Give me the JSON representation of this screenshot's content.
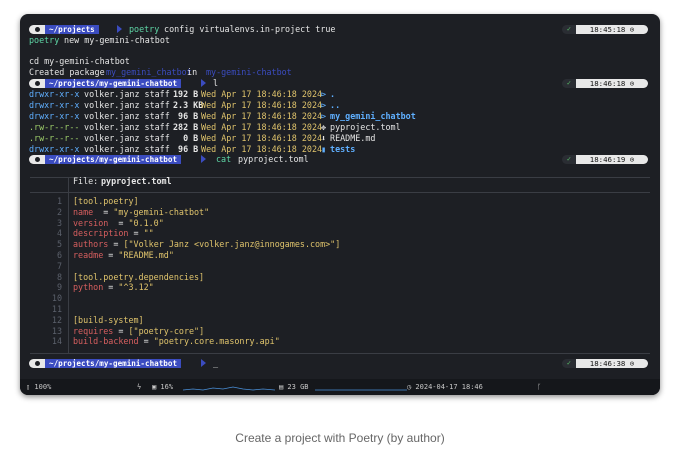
{
  "terminal": {
    "prompt1": {
      "dir": "~/projects",
      "cmd_prog": "poetry",
      "cmd_args": " config virtualenvs.in-project true",
      "ok": "✓",
      "time": "18:45:18 ⊙"
    },
    "line_new": {
      "prog": "poetry",
      "args": " new my-gemini-chatbot"
    },
    "line_cd": "cd my-gemini-chatbot",
    "created": {
      "prefix": "Created package ",
      "pkg": "my_gemini_chatbot",
      "mid": " in ",
      "dir": "my-gemini-chatbot"
    },
    "prompt2": {
      "dir": "~/projects/my-gemini-chatbot",
      "cmd": " l",
      "ok": "✓",
      "time": "18:46:18 ⊙"
    },
    "ls": [
      {
        "perm": "drwxr-xr-x",
        "owner": " volker.janz staff ",
        "size": "192 B ",
        "date": " Wed Apr 17 18:46:18 2024 ",
        "icon": "⊳",
        "name": " ."
      },
      {
        "perm": "drwxr-xr-x",
        "owner": " volker.janz staff ",
        "size": "2.3 KB",
        "date": " Wed Apr 17 18:46:18 2024 ",
        "icon": "⊳",
        "name": " .."
      },
      {
        "perm": "drwxr-xr-x",
        "owner": " volker.janz staff ",
        "size": " 96 B ",
        "date": " Wed Apr 17 18:46:18 2024 ",
        "icon": "⊳",
        "name": " my_gemini_chatbot"
      },
      {
        "perm": ".rw-r--r--",
        "owner": " volker.janz staff ",
        "size": "282 B ",
        "date": " Wed Apr 17 18:46:18 2024 ",
        "icon": "✥",
        "name": " pyproject.toml"
      },
      {
        "perm": ".rw-r--r--",
        "owner": " volker.janz staff ",
        "size": "  0 B ",
        "date": " Wed Apr 17 18:46:18 2024 ",
        "icon": "⬇",
        "name": " README.md"
      },
      {
        "perm": "drwxr-xr-x",
        "owner": " volker.janz staff ",
        "size": " 96 B ",
        "date": " Wed Apr 17 18:46:18 2024 ",
        "icon": "▮",
        "name": " tests"
      }
    ],
    "prompt3": {
      "dir": "~/projects/my-gemini-chatbot",
      "cmd_prog": "cat",
      "cmd_args": " pyproject.toml",
      "ok": "✓",
      "time": "18:46:19 ⊙"
    },
    "file_header": {
      "label": "File: ",
      "name": "pyproject.toml"
    },
    "file_lines": [
      {
        "n": "1",
        "parts": [
          [
            "k-sec",
            "[tool.poetry]"
          ]
        ]
      },
      {
        "n": "2",
        "parts": [
          [
            "k-key",
            "name"
          ],
          [
            "",
            "  = "
          ],
          [
            "k-str",
            "\"my-gemini-chatbot\""
          ]
        ]
      },
      {
        "n": "3",
        "parts": [
          [
            "k-key",
            "version"
          ],
          [
            "",
            "  = "
          ],
          [
            "k-str",
            "\"0.1.0\""
          ]
        ]
      },
      {
        "n": "4",
        "parts": [
          [
            "k-key",
            "description"
          ],
          [
            "",
            " = "
          ],
          [
            "k-str",
            "\"\""
          ]
        ]
      },
      {
        "n": "5",
        "parts": [
          [
            "k-key",
            "authors"
          ],
          [
            "",
            " = "
          ],
          [
            "k-str",
            "[\"Volker Janz <volker.janz@innogames.com>\"]"
          ]
        ]
      },
      {
        "n": "6",
        "parts": [
          [
            "k-key",
            "readme"
          ],
          [
            "",
            " = "
          ],
          [
            "k-str",
            "\"README.md\""
          ]
        ]
      },
      {
        "n": "7",
        "parts": []
      },
      {
        "n": "8",
        "parts": [
          [
            "k-sec",
            "[tool.poetry.dependencies]"
          ]
        ]
      },
      {
        "n": "9",
        "parts": [
          [
            "k-key",
            "python"
          ],
          [
            "",
            " = "
          ],
          [
            "k-str",
            "\"^3.12\""
          ]
        ]
      },
      {
        "n": "10",
        "parts": []
      },
      {
        "n": "11",
        "parts": []
      },
      {
        "n": "12",
        "parts": [
          [
            "k-sec",
            "[build-system]"
          ]
        ]
      },
      {
        "n": "13",
        "parts": [
          [
            "k-key",
            "requires"
          ],
          [
            "",
            " = "
          ],
          [
            "k-str",
            "[\"poetry-core\"]"
          ]
        ]
      },
      {
        "n": "14",
        "parts": [
          [
            "k-key",
            "build-backend"
          ],
          [
            "",
            " = "
          ],
          [
            "k-str",
            "\"poetry.core.masonry.api\""
          ]
        ]
      }
    ],
    "prompt4": {
      "dir": "~/projects/my-gemini-chatbot",
      "cmd": " _",
      "ok": "✓",
      "time": "18:46:38 ⊙"
    }
  },
  "statusbar": {
    "battery": "▯ 100%",
    "bolt": "ϟ",
    "cpu": "▣ 16%",
    "mem": "▤ 23 GB",
    "datetime": "◷ 2024-04-17 18:46",
    "branch": "ᚴ",
    "colors": {
      "spark": "#4a90d9"
    }
  },
  "caption": "Create a project with Poetry (by author)"
}
